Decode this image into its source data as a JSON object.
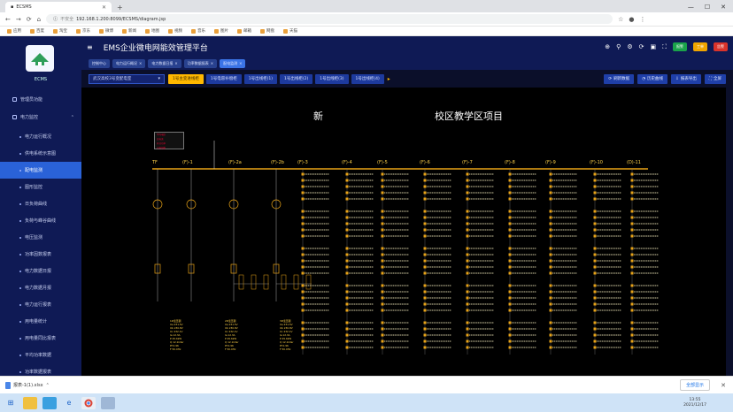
{
  "browser": {
    "tab_title": "ECSMS",
    "new_tab": "+",
    "window_controls": [
      "—",
      "☐",
      "✕"
    ],
    "back": "←",
    "forward": "→",
    "reload": "⟳",
    "home": "⌂",
    "security": "不安全",
    "url": "192.168.1.200:8099/ECSMS/diagram.jsp",
    "bookmarks": [
      "应用",
      "百度",
      "淘宝",
      "京东",
      "微博",
      "新闻",
      "地图",
      "视频",
      "音乐",
      "图片",
      "邮箱",
      "网盘",
      "天猫"
    ]
  },
  "sidebar": {
    "logo_caption": "ECMS",
    "top_item": "管理员功能",
    "section": "电力监控",
    "items": [
      "电力运行概况",
      "供电系统示意图",
      "配电监测",
      "图形监控",
      "日负荷曲线",
      "负荷与峰谷曲线",
      "电压监测",
      "功率因数报表",
      "电力数据日报",
      "电力数据月报",
      "电力运行报表",
      "用电量统计",
      "用电量同比报表",
      "平均功率数据",
      "功率数据报表"
    ]
  },
  "topbar": {
    "menu": "≡",
    "title": "EMS企业微电网能效管理平台",
    "badges": [
      "报警",
      "工单",
      "告警"
    ],
    "icons": [
      "⊕",
      "⚲",
      "⚙",
      "⟳",
      "▣",
      "⛶"
    ]
  },
  "nav_tabs": [
    "控制中心",
    "电力运行概况",
    "电力数据日报",
    "功率数据报表",
    "配电监测"
  ],
  "filter": {
    "select_value": "武汉高校3号变配电室",
    "chips": [
      "1号主变进线柜",
      "1号电容补偿柜",
      "1号出线柜(1)",
      "1号出线柜(2)",
      "1号出线柜(3)",
      "1号出线柜(4)"
    ],
    "actions": [
      "刷新数据",
      "历史曲线",
      "报表导出",
      "全屏"
    ]
  },
  "diagram": {
    "title_left": "新",
    "title_right": "校区教学区项目",
    "feeders": [
      "TF",
      "(F)-1",
      "(F)-2a",
      "(F)-2b",
      "(F)-3",
      "(F)-4",
      "(F)-5",
      "(F)-6",
      "(F)-7",
      "(F)-8",
      "(F)-9",
      "(F)-10",
      "(D)-11"
    ],
    "legend": [
      "平均电压",
      "总电流",
      "有功功率",
      "功率因数"
    ],
    "stat_boxes": [
      "1#变压器",
      "2#变压器",
      "3#变压器"
    ],
    "stat_lines": [
      "Ua 231.5V",
      "Ub 230.8V",
      "Uc 232.1V",
      "Ia 12.3A",
      "P 45.6kW",
      "Q 12.1kVar",
      "Pf 0.96",
      "F 50.0Hz"
    ]
  },
  "download": {
    "file": "报表-1(1).xlsx",
    "show_all": "全部显示"
  },
  "taskbar": {
    "time": "13:55",
    "date": "2021/12/17"
  },
  "colors": {
    "sidebar": "#0f1a55",
    "accent": "#2a62d8",
    "chip_selected": "#ffb800",
    "busbar": "#e8a317",
    "label": "#ffd24a"
  }
}
